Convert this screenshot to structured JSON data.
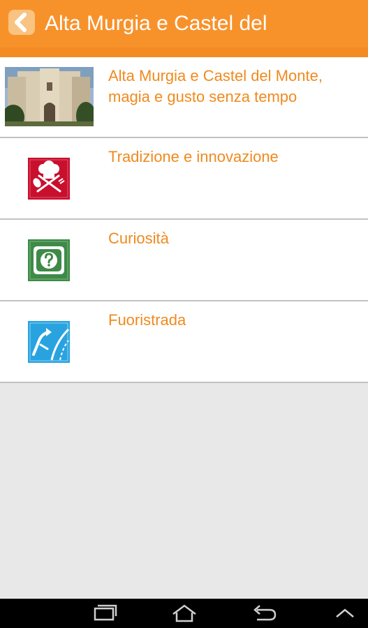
{
  "header": {
    "title": "Alta Murgia e Castel del",
    "back_icon": "chevron-left-icon"
  },
  "items": [
    {
      "label": "Alta Murgia e Castel del Monte, magia e gusto senza tempo",
      "icon": "castle-photo"
    },
    {
      "label": "Tradizione e innovazione",
      "icon": "chef-hat-icon"
    },
    {
      "label": "Curiosità",
      "icon": "question-icon"
    },
    {
      "label": "Fuoristrada",
      "icon": "offroad-road-icon"
    }
  ],
  "navbar": {
    "icons": [
      "recent-apps-icon",
      "home-icon",
      "back-icon",
      "up-chevron-icon"
    ]
  },
  "colors": {
    "accent": "#f7922b",
    "label": "#f08a1e",
    "chef_red": "#c8102e",
    "question_green": "#3e8a47",
    "offroad_blue": "#29a3e0"
  }
}
